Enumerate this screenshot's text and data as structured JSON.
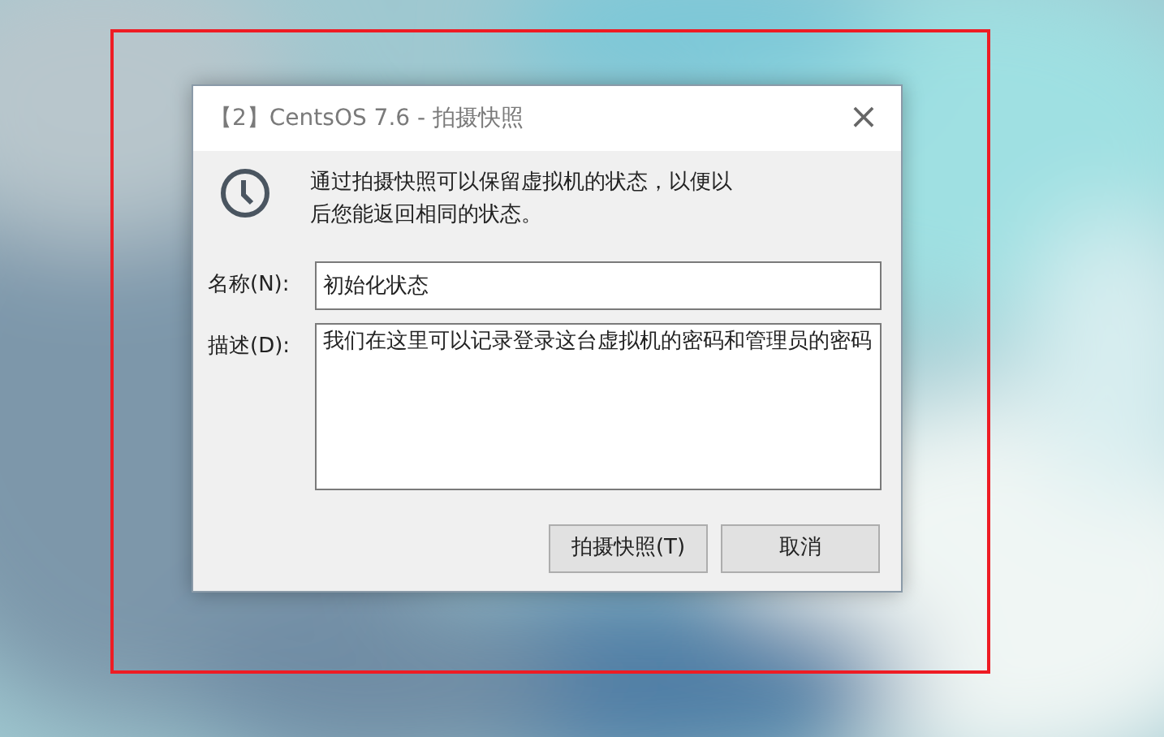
{
  "window": {
    "title": "【2】CentsOS 7.6 - 拍摄快照",
    "close": "×"
  },
  "info": "通过拍摄快照可以保留虚拟机的状态，以便以后您能返回相同的状态。",
  "fields": [
    {
      "label": "名称(N):",
      "value": "初始化状态",
      "kind": "line"
    },
    {
      "label": "描述(D):",
      "value": "我们在这里可以记录登录这台虚拟机的密码和管理员的密码",
      "kind": "area"
    }
  ],
  "buttons": [
    "拍摄快照(T)",
    "取消"
  ]
}
